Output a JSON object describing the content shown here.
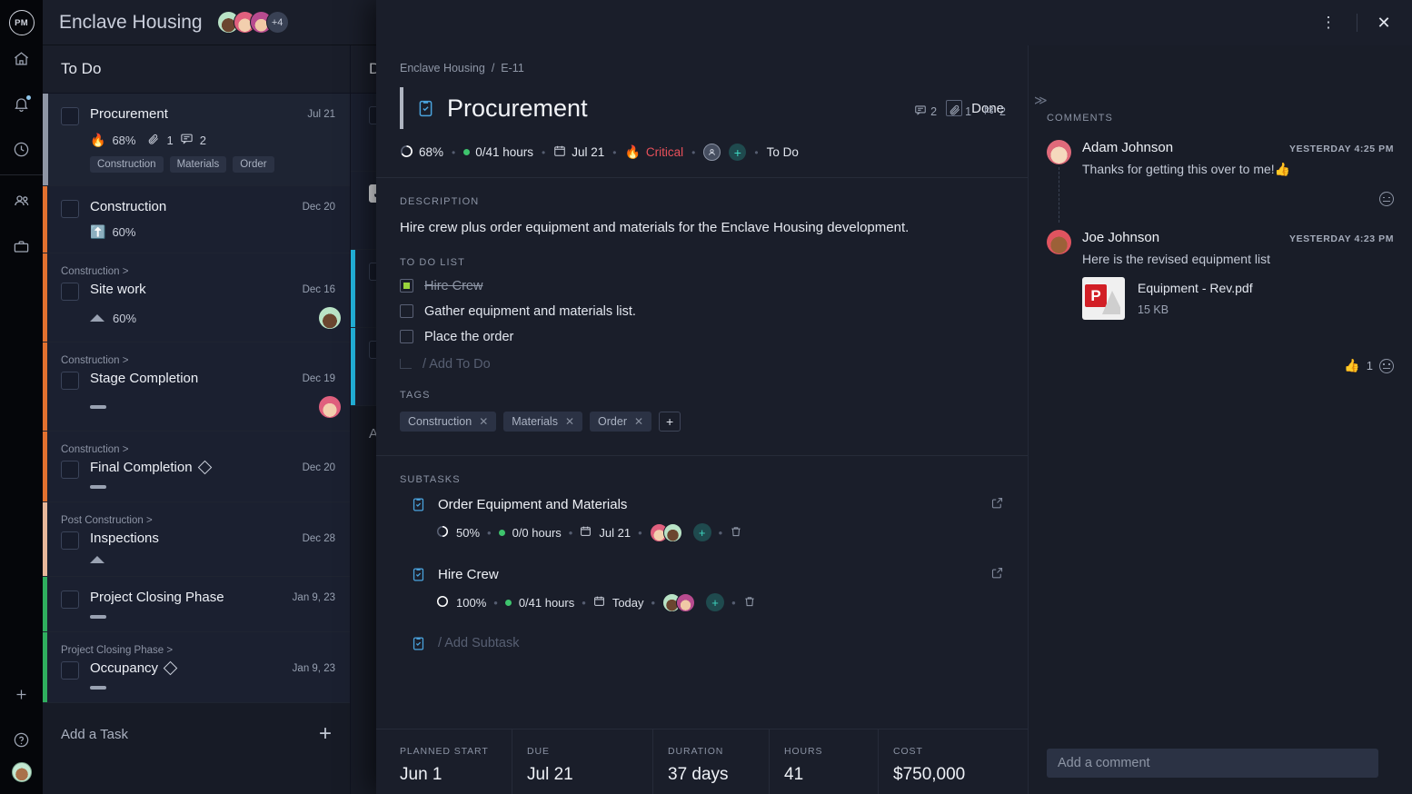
{
  "rail": {
    "logo": "PM",
    "icons": [
      "home-icon",
      "bell-icon",
      "clock-icon",
      "people-icon",
      "briefcase-icon",
      "plus-icon",
      "help-icon",
      "user-avatar"
    ]
  },
  "topbar": {
    "project_title": "Enclave Housing",
    "avatar_overflow": "+4"
  },
  "board": {
    "columns": [
      {
        "title": "To Do"
      },
      {
        "title": "D"
      }
    ],
    "add_task_label": "Add a Task",
    "add_task_plus": "+",
    "tasks": [
      {
        "parent": "",
        "name": "Procurement",
        "date": "Jul 21",
        "progress": "68%",
        "marker": "fire",
        "attachments": "1",
        "comments": "2",
        "tags": [
          "Construction",
          "Materials",
          "Order"
        ],
        "bar_color": "#8e95a4",
        "selected": true
      },
      {
        "parent": "",
        "name": "Construction",
        "date": "Dec 20",
        "progress": "60%",
        "marker": "up-arrow",
        "tags": [],
        "bar_color": "#e2702f"
      },
      {
        "parent": "Construction >",
        "name": "Site work",
        "date": "Dec 16",
        "progress": "60%",
        "marker": "triangle",
        "tags": [],
        "bar_color": "#e2702f",
        "avatar": "a1"
      },
      {
        "parent": "Construction >",
        "name": "Stage Completion",
        "date": "Dec 19",
        "progress": "",
        "marker": "dash",
        "tags": [],
        "bar_color": "#e2702f",
        "avatar": "a2"
      },
      {
        "parent": "Construction >",
        "name": "Final Completion",
        "date": "Dec 20",
        "progress": "",
        "marker": "dash",
        "milestone": true,
        "tags": [],
        "bar_color": "#e2702f"
      },
      {
        "parent": "Post Construction >",
        "name": "Inspections",
        "date": "Dec 28",
        "progress": "",
        "marker": "triangle",
        "tags": [],
        "bar_color": "#e8b79a"
      },
      {
        "parent": "",
        "name": "Project Closing Phase",
        "date": "Jan 9, 23",
        "progress": "",
        "marker": "dash",
        "tags": [],
        "bar_color": "#2fae5e"
      },
      {
        "parent": "Project Closing Phase >",
        "name": "Occupancy",
        "date": "Jan 9, 23",
        "progress": "",
        "marker": "dash",
        "milestone": true,
        "tags": [],
        "bar_color": "#2fae5e"
      }
    ]
  },
  "modal": {
    "kebab": "⋮",
    "close": "✕",
    "breadcrumb": {
      "project": "Enclave Housing",
      "divider": "/",
      "code": "E-11"
    },
    "counts": {
      "comments": "2",
      "attachments": "1",
      "subtasks": "2"
    },
    "title": "Procurement",
    "done_label": "Done",
    "meta": {
      "progress": "68%",
      "hours": "0/41 hours",
      "due": "Jul 21",
      "priority": "Critical",
      "status": "To Do"
    },
    "description": {
      "label": "DESCRIPTION",
      "text": "Hire crew plus order equipment and materials for the Enclave Housing development."
    },
    "todo": {
      "label": "TO DO LIST",
      "items": [
        {
          "text": "Hire Crew",
          "done": true
        },
        {
          "text": "Gather equipment and materials list.",
          "done": false
        },
        {
          "text": "Place the order",
          "done": false
        }
      ],
      "add_placeholder": "/ Add To Do"
    },
    "tags": {
      "label": "TAGS",
      "items": [
        "Construction",
        "Materials",
        "Order"
      ],
      "add": "+"
    },
    "subtasks": {
      "label": "SUBTASKS",
      "items": [
        {
          "name": "Order Equipment and Materials",
          "progress": "50%",
          "hours": "0/0 hours",
          "due": "Jul 21"
        },
        {
          "name": "Hire Crew",
          "progress": "100%",
          "hours": "0/41 hours",
          "due": "Today"
        }
      ],
      "add_placeholder": "/ Add Subtask"
    },
    "stats": [
      {
        "label": "PLANNED START",
        "value": "Jun 1"
      },
      {
        "label": "DUE",
        "value": "Jul 21"
      },
      {
        "label": "DURATION",
        "value": "37 days"
      },
      {
        "label": "HOURS",
        "value": "41"
      },
      {
        "label": "COST",
        "value": "$750,000"
      }
    ]
  },
  "comments": {
    "collapse": "≫",
    "label": "COMMENTS",
    "items": [
      {
        "author": "Adam Johnson",
        "time": "YESTERDAY 4:25 PM",
        "text": "Thanks for getting this over to me!👍",
        "avatar": "adam",
        "reaction_count": ""
      },
      {
        "author": "Joe Johnson",
        "time": "YESTERDAY 4:23 PM",
        "text": "Here is the revised equipment list",
        "avatar": "joe",
        "attachment": {
          "name": "Equipment - Rev.pdf",
          "size": "15 KB"
        },
        "reaction": "👍",
        "reaction_count": "1"
      }
    ],
    "input_placeholder": "Add a comment"
  }
}
